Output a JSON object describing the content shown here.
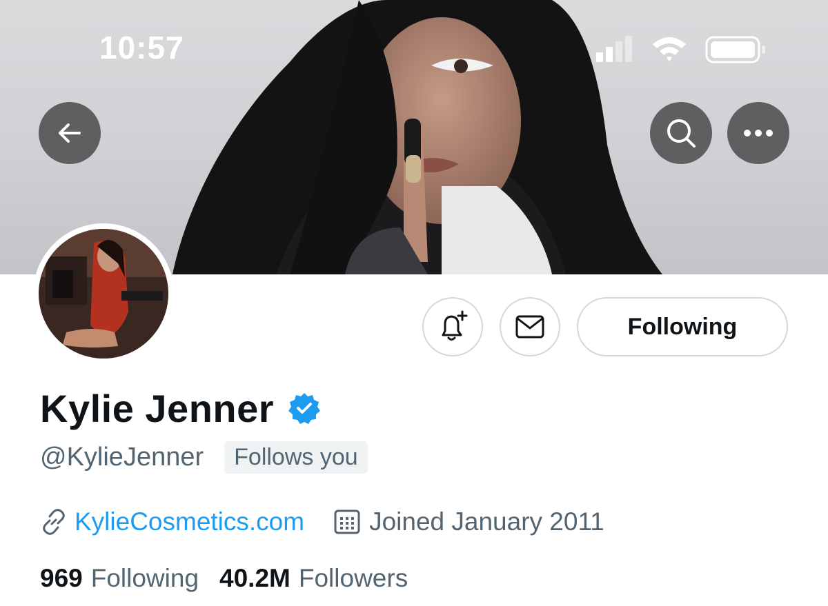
{
  "status_bar": {
    "time": "10:57"
  },
  "header": {
    "back_icon": "arrow-left-icon",
    "search_icon": "search-icon",
    "more_icon": "more-horizontal-icon"
  },
  "profile": {
    "display_name": "Kylie Jenner",
    "verified": true,
    "handle": "@KylieJenner",
    "follows_you_label": "Follows you",
    "website": "KylieCosmetics.com",
    "joined": "Joined January 2011",
    "following_count": "969",
    "following_label": "Following",
    "followers_count": "40.2M",
    "followers_label": "Followers"
  },
  "actions": {
    "notify_icon": "bell-plus-icon",
    "message_icon": "mail-icon",
    "follow_button_label": "Following"
  },
  "colors": {
    "accent_link": "#1d9bf0",
    "verified_badge": "#1d9bf0",
    "secondary_text": "#536471",
    "primary_text": "#0f1419",
    "border": "#cfd9de"
  }
}
